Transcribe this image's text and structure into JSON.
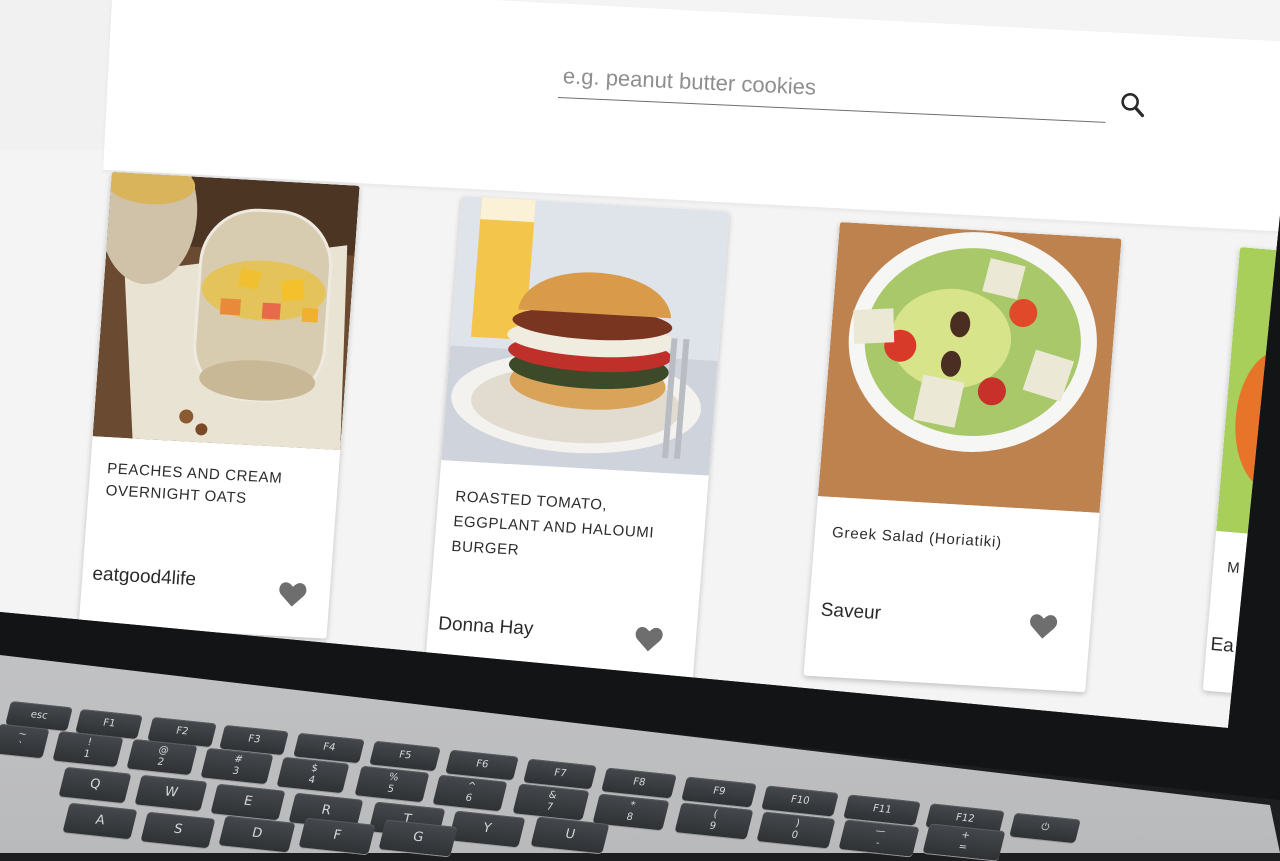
{
  "search": {
    "placeholder": "e.g. peanut butter cookies",
    "button_icon": "search-icon"
  },
  "recipes": [
    {
      "title": "PEACHES AND CREAM\nOVERNIGHT OATS",
      "source": "eatgood4life",
      "favorite_icon": "heart-icon"
    },
    {
      "title": "ROASTED TOMATO,\nEGGPLANT AND HALOUMI\nBURGER",
      "source": "Donna Hay",
      "favorite_icon": "heart-icon"
    },
    {
      "title": "Greek Salad (Horiatiki)",
      "source": "Saveur",
      "favorite_icon": "heart-icon"
    },
    {
      "title": "M",
      "source": "Ea",
      "favorite_icon": "heart-icon"
    }
  ],
  "keyboard": {
    "fn_row": [
      "esc",
      "F1",
      "F2",
      "F3",
      "F4",
      "F5",
      "F6",
      "F7",
      "F8",
      "F9",
      "F10",
      "F11",
      "F12"
    ],
    "number_row": [
      "~\n`",
      "!\n1",
      "@\n2",
      "#\n3",
      "$\n4",
      "%\n5",
      "^\n6",
      "&\n7",
      "*\n8",
      "(\n9",
      ")\n0",
      "—\n-",
      "+\n="
    ],
    "top_row": [
      "Q",
      "W",
      "E",
      "R",
      "T",
      "Y",
      "U"
    ],
    "home_row": [
      "A",
      "S",
      "D",
      "F",
      "G"
    ]
  },
  "colors": {
    "screen_bg": "#f4f4f4",
    "card_bg": "#ffffff",
    "heart": "#6e6e6e",
    "key": "#3a3d41"
  }
}
